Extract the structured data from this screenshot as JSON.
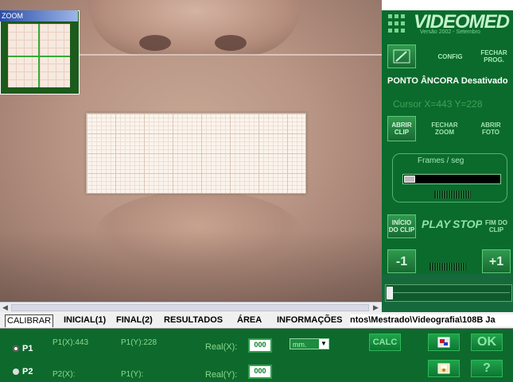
{
  "zoom": {
    "title": "ZOOM"
  },
  "brand": {
    "name": "VIDEOMED",
    "version": "Versão 2002 - Setembro"
  },
  "panel": {
    "buttons_row1": {
      "config": "CONFIG",
      "close_prog": "FECHAR PROG."
    },
    "anchor_status": "PONTO ÂNCORA Desativado",
    "cursor_readout": "Cursor X=443 Y=228",
    "buttons_row2": {
      "open_clip": "ABRIR CLIP",
      "close_zoom": "FECHAR ZOOM",
      "open_photo": "ABRIR FOTO"
    },
    "fps_label": "Frames / seg",
    "playback": {
      "start_clip": "INÍCIO DO CLIP",
      "play": "PLAY",
      "stop": "STOP",
      "end_clip": "FIM DO CLIP"
    },
    "frame_step": {
      "back": "-1",
      "forward": "+1"
    }
  },
  "tabs": [
    {
      "label": "CALIBRAR"
    },
    {
      "label": "INICIAL(1)"
    },
    {
      "label": "FINAL(2)"
    },
    {
      "label": "RESULTADOS"
    },
    {
      "label": "ÁREA"
    },
    {
      "label": "INFORMAÇÕES"
    }
  ],
  "path_text": "ntos\\Mestrado\\Videografia\\108B Ja",
  "calibrate": {
    "p1_label": "P1",
    "p2_label": "P2",
    "p1x": "P1(X):443",
    "p1y": "P1(Y):228",
    "p2x": "P2(X):",
    "p2y": "P1(Y):",
    "real_x_label": "Real(X):",
    "real_y_label": "Real(Y):",
    "real_x_value": "000",
    "real_y_value": "000",
    "unit": "mm.",
    "calc_button": "CALC",
    "ok_button": "OK",
    "help_button": "?"
  }
}
